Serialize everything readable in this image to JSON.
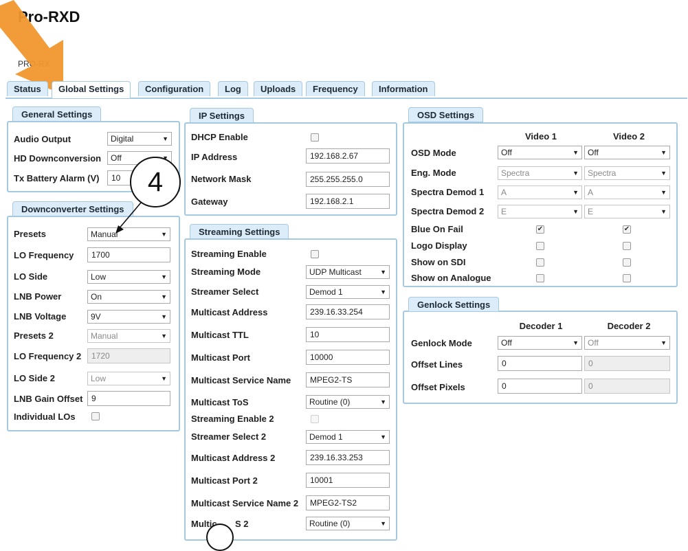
{
  "app": {
    "title": "Pro-RXD",
    "subtitle": "PRO-RX"
  },
  "tabs": [
    "Status",
    "Global Settings",
    "Configuration",
    "Log",
    "Uploads",
    "Frequency",
    "Information"
  ],
  "general": {
    "legend": "General Settings",
    "audio_output_label": "Audio Output",
    "audio_output_value": "Digital",
    "hd_down_label": "HD Downconversion",
    "hd_down_value": "Off",
    "tx_batt_label": "Tx Battery Alarm (V)",
    "tx_batt_value": "10"
  },
  "downconverter": {
    "legend": "Downconverter Settings",
    "presets_label": "Presets",
    "presets_value": "Manual",
    "lo_freq_label": "LO Frequency",
    "lo_freq_value": "1700",
    "lo_side_label": "LO Side",
    "lo_side_value": "Low",
    "lnb_power_label": "LNB Power",
    "lnb_power_value": "On",
    "lnb_voltage_label": "LNB Voltage",
    "lnb_voltage_value": "9V",
    "presets2_label": "Presets 2",
    "presets2_value": "Manual",
    "lo_freq2_label": "LO Frequency 2",
    "lo_freq2_value": "1720",
    "lo_side2_label": "LO Side 2",
    "lo_side2_value": "Low",
    "lnb_gain_label": "LNB Gain Offset",
    "lnb_gain_value": "9",
    "individual_los_label": "Individual LOs"
  },
  "ip": {
    "legend": "IP Settings",
    "dhcp_label": "DHCP Enable",
    "ip_label": "IP Address",
    "ip_value": "192.168.2.67",
    "mask_label": "Network Mask",
    "mask_value": "255.255.255.0",
    "gw_label": "Gateway",
    "gw_value": "192.168.2.1"
  },
  "streaming": {
    "legend": "Streaming Settings",
    "enable_label": "Streaming Enable",
    "mode_label": "Streaming Mode",
    "mode_value": "UDP Multicast",
    "streamer_label": "Streamer Select",
    "streamer_value": "Demod 1",
    "mc_addr_label": "Multicast Address",
    "mc_addr_value": "239.16.33.254",
    "mc_ttl_label": "Multicast TTL",
    "mc_ttl_value": "10",
    "mc_port_label": "Multicast Port",
    "mc_port_value": "10000",
    "mc_svc_label": "Multicast Service Name",
    "mc_svc_value": "MPEG2-TS",
    "mc_tos_label": "Multicast ToS",
    "mc_tos_value": "Routine (0)",
    "enable2_label": "Streaming Enable 2",
    "streamer2_label": "Streamer Select 2",
    "streamer2_value": "Demod 1",
    "mc_addr2_label": "Multicast Address 2",
    "mc_addr2_value": "239.16.33.253",
    "mc_port2_label": "Multicast Port 2",
    "mc_port2_value": "10001",
    "mc_svc2_label": "Multicast Service Name 2",
    "mc_svc2_value": "MPEG2-TS2",
    "mc_tos2_label": "Multic",
    "mc_tos2_label_tail": "S 2",
    "mc_tos2_value": "Routine (0)"
  },
  "osd": {
    "legend": "OSD Settings",
    "col1": "Video 1",
    "col2": "Video 2",
    "osd_mode_label": "OSD Mode",
    "osd_mode_v1": "Off",
    "osd_mode_v2": "Off",
    "eng_mode_label": "Eng. Mode",
    "eng_mode_v1": "Spectra",
    "eng_mode_v2": "Spectra",
    "sd1_label": "Spectra Demod 1",
    "sd1_v1": "A",
    "sd1_v2": "A",
    "sd2_label": "Spectra Demod 2",
    "sd2_v1": "E",
    "sd2_v2": "E",
    "blue_label": "Blue On Fail",
    "logo_label": "Logo Display",
    "sdi_label": "Show on SDI",
    "analogue_label": "Show on Analogue"
  },
  "genlock": {
    "legend": "Genlock Settings",
    "col1": "Decoder 1",
    "col2": "Decoder 2",
    "mode_label": "Genlock Mode",
    "mode_d1": "Off",
    "mode_d2": "Off",
    "lines_label": "Offset Lines",
    "lines_d1": "0",
    "lines_d2": "0",
    "pixels_label": "Offset Pixels",
    "pixels_d1": "0",
    "pixels_d2": "0"
  },
  "annotation": {
    "callout_number": "4"
  },
  "colors": {
    "tab_bg": "#dcecf8",
    "border": "#a6c9e2",
    "arrow": "#f0962e"
  }
}
